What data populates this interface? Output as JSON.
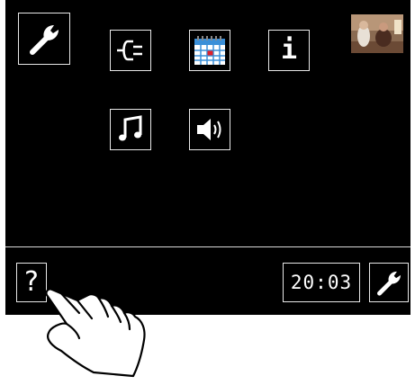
{
  "colors": {
    "screen_background": "#000000",
    "tile_border": "#e8e8e8",
    "icon_foreground": "#ffffff",
    "calendar_blue": "#3a8fd8",
    "calendar_red": "#e0202a"
  },
  "settings_tile": {
    "icon": "wrench-icon"
  },
  "menu_icons": [
    {
      "icon": "power-plug-icon"
    },
    {
      "icon": "calendar-icon"
    },
    {
      "icon": "info-icon",
      "label": "i"
    },
    {
      "icon": "music-note-icon"
    },
    {
      "icon": "speaker-volume-icon"
    }
  ],
  "thumbnail": {
    "icon": "photo-thumbnail"
  },
  "bottom_bar": {
    "help_label": "?",
    "time": "20:03",
    "settings_icon": "wrench-icon"
  },
  "pointer": {
    "icon": "pointing-hand-icon"
  }
}
